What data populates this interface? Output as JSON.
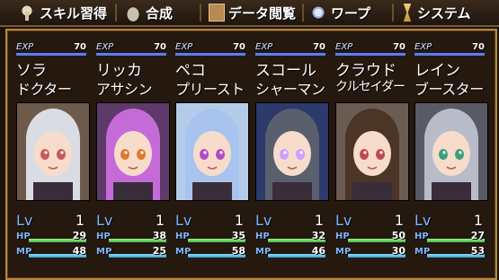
{
  "menu": [
    {
      "label": "スキル習得",
      "icon": "skill-tree-icon"
    },
    {
      "label": "合成",
      "icon": "craft-pot-icon"
    },
    {
      "label": "データ閲覧",
      "icon": "book-icon"
    },
    {
      "label": "ワープ",
      "icon": "warp-icon"
    },
    {
      "label": "システム",
      "icon": "hourglass-icon"
    }
  ],
  "labels": {
    "exp": "EXP",
    "lv": "Lv",
    "hp": "HP",
    "mp": "MP"
  },
  "party": [
    {
      "name": "ソラ",
      "job": "ドクター",
      "exp": 70,
      "exp_fraction": 1.0,
      "lv": 1,
      "hp": 29,
      "hp_fraction": 1.0,
      "mp": 48,
      "mp_fraction": 1.0,
      "hair_color": "#d9dde3",
      "eye_color": "#c85a5a",
      "bg_color": "#6d5a4a"
    },
    {
      "name": "リッカ",
      "job": "アサシン",
      "exp": 70,
      "exp_fraction": 1.0,
      "lv": 1,
      "hp": 38,
      "hp_fraction": 1.0,
      "mp": 25,
      "mp_fraction": 1.0,
      "hair_color": "#c56bd8",
      "eye_color": "#e07a2a",
      "bg_color": "#5e3a6a"
    },
    {
      "name": "ペコ",
      "job": "プリースト",
      "exp": 70,
      "exp_fraction": 1.0,
      "lv": 1,
      "hp": 35,
      "hp_fraction": 1.0,
      "mp": 58,
      "mp_fraction": 1.0,
      "hair_color": "#a8c4ee",
      "eye_color": "#b04cc7",
      "bg_color": "#b5cce8"
    },
    {
      "name": "スコール",
      "job": "シャーマン",
      "exp": 70,
      "exp_fraction": 1.0,
      "lv": 1,
      "hp": 32,
      "hp_fraction": 1.0,
      "mp": 46,
      "mp_fraction": 1.0,
      "hair_color": "#5a5f6e",
      "eye_color": "#c9a0ff",
      "bg_color": "#2c3a6b"
    },
    {
      "name": "クラウド",
      "job": "クルセイダー",
      "exp": 70,
      "exp_fraction": 1.0,
      "lv": 1,
      "hp": 50,
      "hp_fraction": 1.0,
      "mp": 30,
      "mp_fraction": 1.0,
      "hair_color": "#4a3527",
      "eye_color": "#c04a50",
      "bg_color": "#6a5c52"
    },
    {
      "name": "レイン",
      "job": "ブースター",
      "exp": 70,
      "exp_fraction": 1.0,
      "lv": 1,
      "hp": 27,
      "hp_fraction": 1.0,
      "mp": 53,
      "mp_fraction": 1.0,
      "hair_color": "#b8bcc8",
      "eye_color": "#3aa07a",
      "bg_color": "#5a5a66"
    }
  ]
}
